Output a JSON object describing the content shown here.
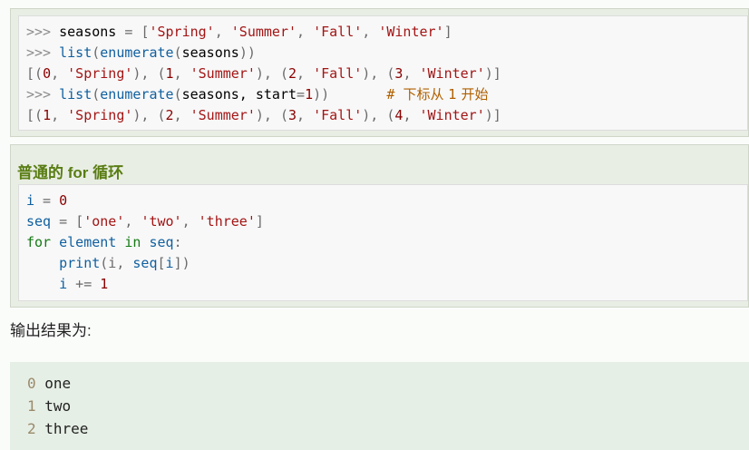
{
  "block1": {
    "lines": [
      {
        "prompt": ">>> ",
        "parts": [
          "seasons",
          " = ",
          "[",
          "'Spring'",
          ", ",
          "'Summer'",
          ", ",
          "'Fall'",
          ", ",
          "'Winter'",
          "]"
        ]
      },
      {
        "prompt": ">>> ",
        "parts": [
          "list",
          "(",
          "enumerate",
          "(",
          "seasons",
          "))"
        ]
      },
      {
        "prompt": "",
        "parts": [
          "[(",
          "0",
          ", ",
          "'Spring'",
          "), (",
          "1",
          ", ",
          "'Summer'",
          "), (",
          "2",
          ", ",
          "'Fall'",
          "), (",
          "3",
          ", ",
          "'Winter'",
          ")]"
        ]
      },
      {
        "prompt": ">>> ",
        "parts": [
          "list",
          "(",
          "enumerate",
          "(",
          "seasons, start",
          "=",
          "1",
          "))",
          "       # ",
          "下标从 1 开始"
        ]
      },
      {
        "prompt": "",
        "parts": [
          "[(",
          "1",
          ", ",
          "'Spring'",
          "), (",
          "2",
          ", ",
          "'Summer'",
          "), (",
          "3",
          ", ",
          "'Fall'",
          "), (",
          "4",
          ", ",
          "'Winter'",
          ")]"
        ]
      }
    ]
  },
  "block2": {
    "heading": "普通的 for 循环",
    "lines": [
      [
        "i",
        " = ",
        "0"
      ],
      [
        "seq",
        " = ",
        "[",
        "'one'",
        ", ",
        "'two'",
        ", ",
        "'three'",
        "]"
      ],
      [
        "for",
        " ",
        "element",
        " ",
        "in",
        " ",
        "seq",
        ":"
      ],
      [
        "    ",
        "print",
        "(i, ",
        "seq",
        "[",
        "i",
        "])"
      ],
      [
        "    ",
        "i",
        " += ",
        "1"
      ]
    ]
  },
  "result_label": "输出结果为:",
  "output": [
    {
      "num": "0",
      "text": " one"
    },
    {
      "num": "1",
      "text": " two"
    },
    {
      "num": "2",
      "text": " three"
    }
  ]
}
